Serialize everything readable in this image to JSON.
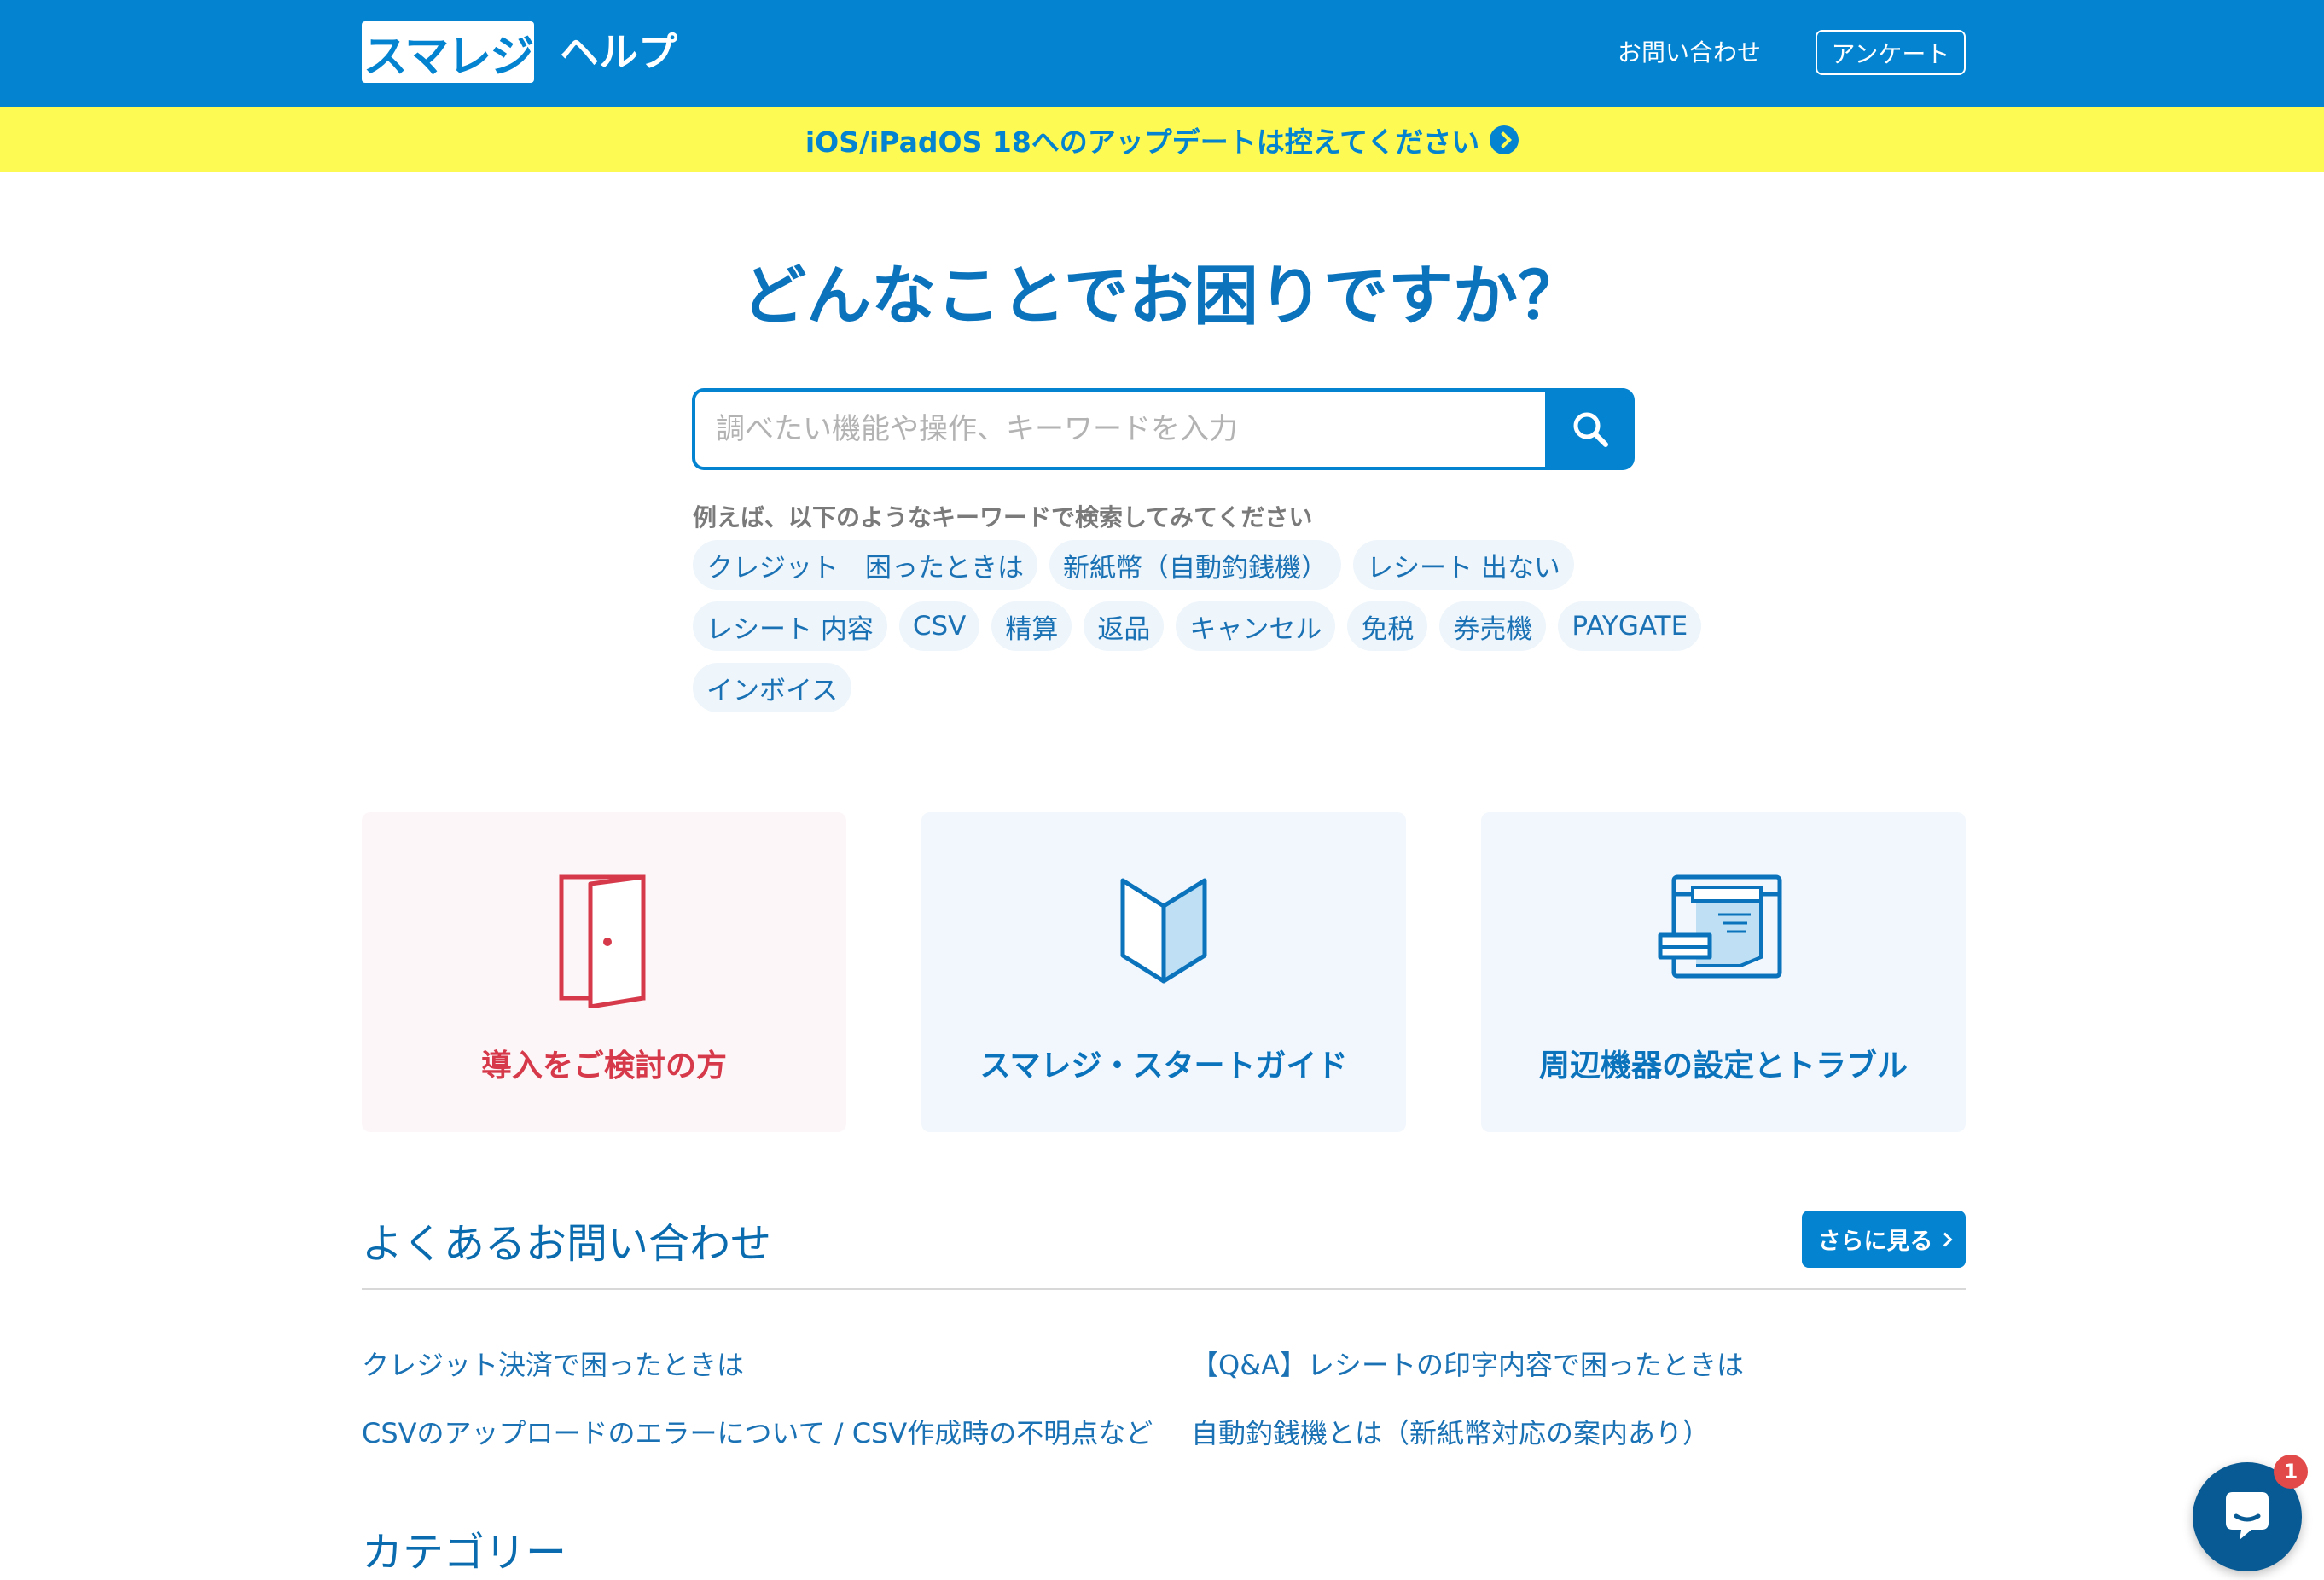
{
  "header": {
    "logo_text": "スマレジ",
    "help_label": "ヘルプ",
    "contact_link": "お問い合わせ",
    "survey_button": "アンケート"
  },
  "notice": {
    "text": "iOS/iPadOS 18へのアップデートは控えてください"
  },
  "hero": {
    "title": "どんなことでお困りですか？",
    "search_placeholder": "調べたい機能や操作、キーワードを入力",
    "keyword_hint": "例えば、以下のようなキーワードで検索してみてください",
    "keywords": [
      "クレジット　困ったときは",
      "新紙幣（自動釣銭機）",
      "レシート 出ない",
      "レシート 内容",
      "CSV",
      "精算",
      "返品",
      "キャンセル",
      "免税",
      "券売機",
      "PAYGATE",
      "インボイス"
    ]
  },
  "cards": [
    {
      "label": "導入をご検討の方",
      "icon": "door-icon",
      "color": "#d6394a",
      "bg": "#fdf6f8"
    },
    {
      "label": "スマレジ・スタートガイド",
      "icon": "book-icon",
      "color": "#0a73bc",
      "bg": "#f1f7fc"
    },
    {
      "label": "周辺機器の設定とトラブル",
      "icon": "printer-icon",
      "color": "#0a73bc",
      "bg": "#f1f7fc"
    }
  ],
  "faq": {
    "title": "よくあるお問い合わせ",
    "more_button": "さらに見る",
    "links": [
      "クレジット決済で困ったときは",
      "【Q&A】レシートの印字内容で困ったときは",
      "CSVのアップロードのエラーについて / CSV作成時の不明点など",
      "自動釣銭機とは（新紙幣対応の案内あり）"
    ]
  },
  "category": {
    "title": "カテゴリー"
  },
  "chat": {
    "badge_count": "1"
  },
  "colors": {
    "brand_blue": "#0383d0",
    "notice_yellow": "#fdfa53",
    "accent_red": "#d6394a"
  }
}
